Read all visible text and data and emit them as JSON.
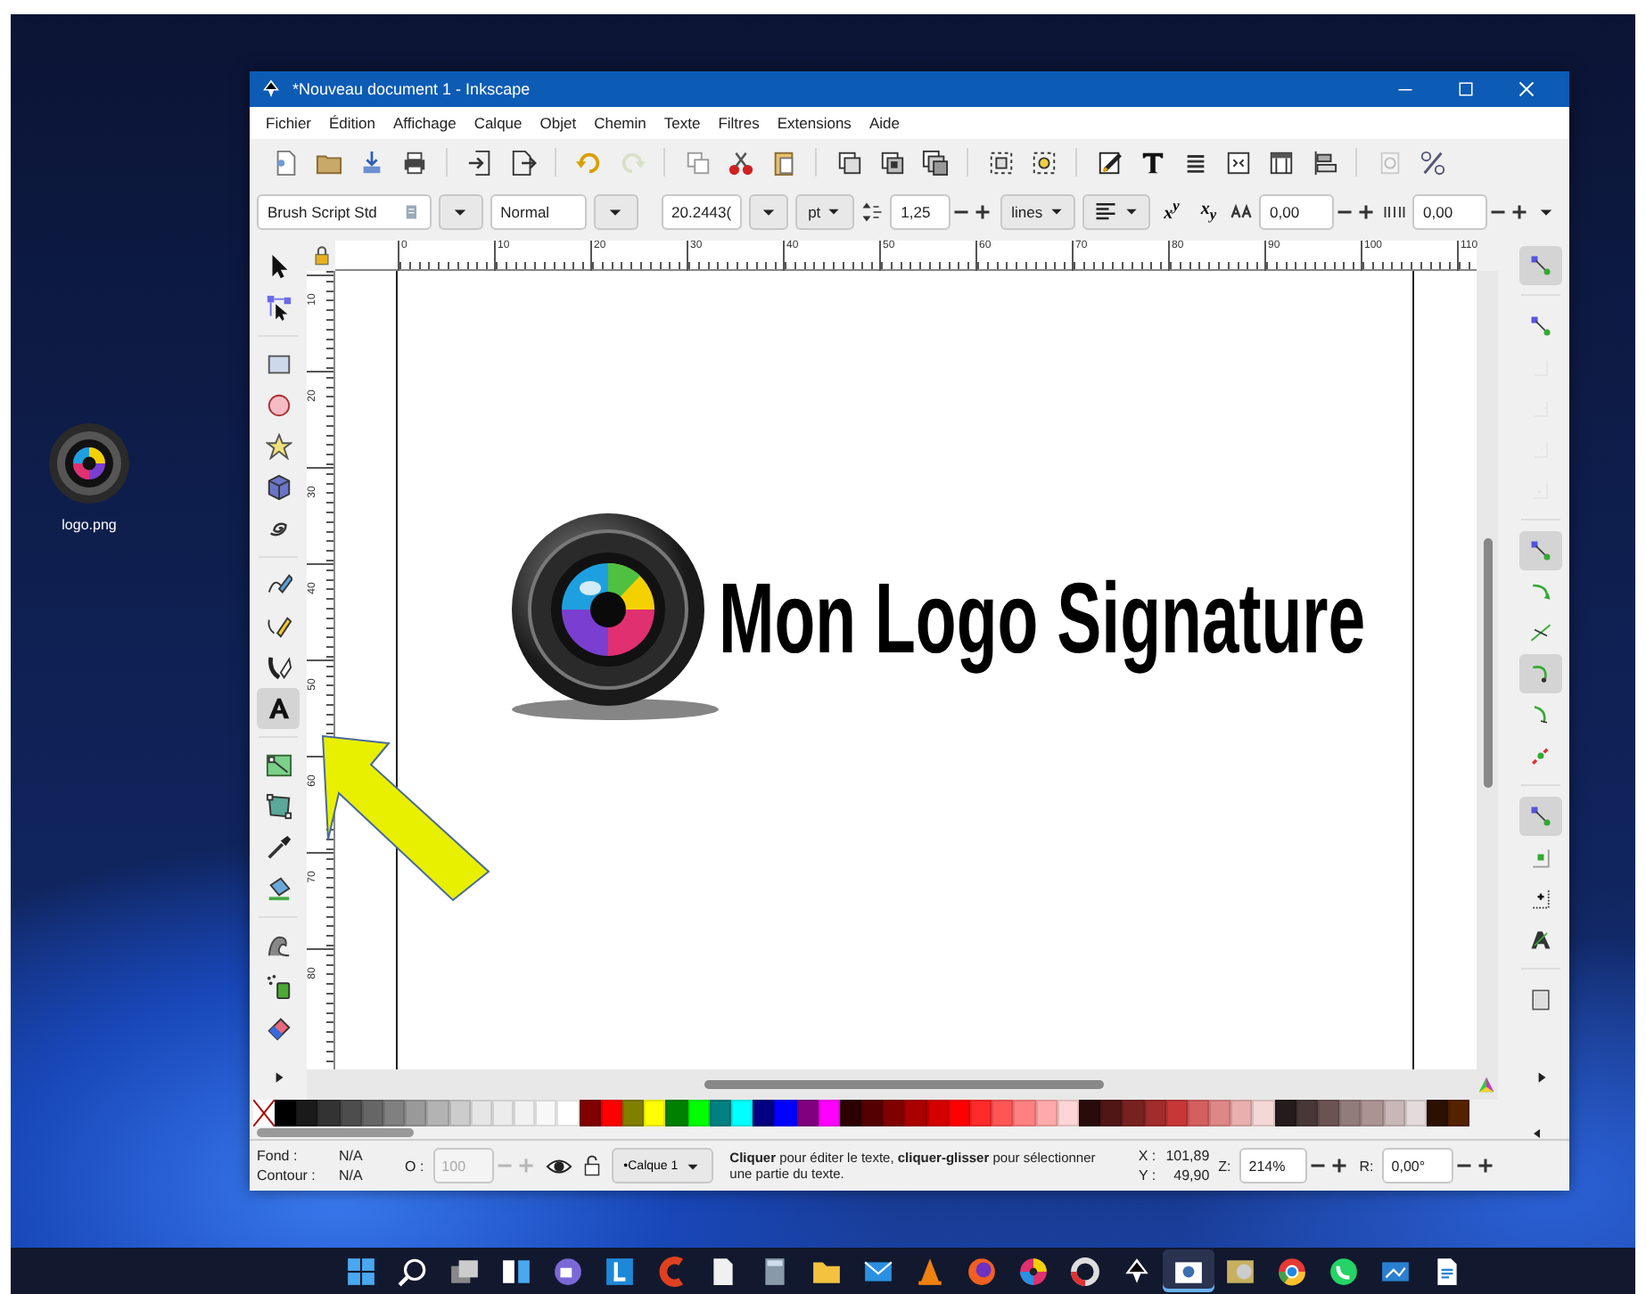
{
  "desktop_icons": [
    {
      "label": "logo.png"
    }
  ],
  "window": {
    "title": "*Nouveau document 1 - Inkscape"
  },
  "menu": [
    "Fichier",
    "Édition",
    "Affichage",
    "Calque",
    "Objet",
    "Chemin",
    "Texte",
    "Filtres",
    "Extensions",
    "Aide"
  ],
  "text_toolbar": {
    "font_family": "Brush Script Std",
    "font_style": "Normal",
    "font_size": "20.2443(",
    "unit": "pt",
    "line_spacing": "1,25",
    "line_spacing_mode": "lines",
    "superscript": "x$^{y}$",
    "subscript": "x$_{y}$",
    "word_spacing": "0,00",
    "letter_spacing": "0,00"
  },
  "tools": [
    {
      "selected": false
    },
    {
      "selected": false
    },
    {
      "selected": false
    },
    {
      "selected": false
    },
    {
      "selected": false
    },
    {
      "selected": false
    },
    {
      "selected": false
    },
    {
      "selected": false
    },
    {
      "selected": false
    },
    {
      "selected": false
    },
    {
      "selected": true
    },
    {
      "selected": false
    },
    {
      "selected": false
    },
    {
      "selected": false
    },
    {
      "selected": false
    },
    {
      "selected": false
    },
    {
      "selected": false
    },
    {
      "selected": false
    }
  ],
  "rulers": {
    "horizontal": [
      "0",
      "10",
      "20",
      "30",
      "40",
      "50",
      "60",
      "70",
      "80",
      "90",
      "100",
      "110"
    ],
    "vertical": [
      "10",
      "20",
      "30",
      "40",
      "50",
      "60",
      "70",
      "80"
    ]
  },
  "canvas": {
    "logo_text": "Mon Logo Signature"
  },
  "snap_toggles": [
    {
      "on": true,
      "disabled": false
    },
    {
      "on": false,
      "disabled": false
    },
    {
      "on": false,
      "disabled": true
    },
    {
      "on": false,
      "disabled": true
    },
    {
      "on": false,
      "disabled": true
    },
    {
      "on": false,
      "disabled": true
    },
    {
      "on": true,
      "disabled": false
    },
    {
      "on": false,
      "disabled": false
    },
    {
      "on": false,
      "disabled": false
    },
    {
      "on": true,
      "disabled": false
    },
    {
      "on": false,
      "disabled": false
    },
    {
      "on": false,
      "disabled": false
    },
    {
      "on": true,
      "disabled": false
    },
    {
      "on": false,
      "disabled": false
    },
    {
      "on": false,
      "disabled": false
    },
    {
      "on": false,
      "disabled": false
    },
    {
      "on": false,
      "disabled": false
    }
  ],
  "palette": [
    {
      "color": "#000000"
    },
    {
      "color": "#1a1a1a"
    },
    {
      "color": "#333333"
    },
    {
      "color": "#4d4d4d"
    },
    {
      "color": "#666666"
    },
    {
      "color": "#808080"
    },
    {
      "color": "#999999"
    },
    {
      "color": "#b3b3b3"
    },
    {
      "color": "#cccccc"
    },
    {
      "color": "#e6e6e6"
    },
    {
      "color": "#ececec"
    },
    {
      "color": "#f2f2f2"
    },
    {
      "color": "#f8f8f8"
    },
    {
      "color": "#ffffff"
    },
    {
      "color": "#800000"
    },
    {
      "color": "#ff0000"
    },
    {
      "color": "#808000"
    },
    {
      "color": "#ffff00"
    },
    {
      "color": "#008000"
    },
    {
      "color": "#00ff00"
    },
    {
      "color": "#008080"
    },
    {
      "color": "#00ffff"
    },
    {
      "color": "#000080"
    },
    {
      "color": "#0000ff"
    },
    {
      "color": "#800080"
    },
    {
      "color": "#ff00ff"
    },
    {
      "color": "#2b0000"
    },
    {
      "color": "#550000"
    },
    {
      "color": "#800000"
    },
    {
      "color": "#aa0000"
    },
    {
      "color": "#d40000"
    },
    {
      "color": "#ff0000"
    },
    {
      "color": "#ff2a2a"
    },
    {
      "color": "#ff5555"
    },
    {
      "color": "#ff8080"
    },
    {
      "color": "#ffaaaa"
    },
    {
      "color": "#ffd5d5"
    },
    {
      "color": "#280b0b"
    },
    {
      "color": "#501616"
    },
    {
      "color": "#782121"
    },
    {
      "color": "#a02c2c"
    },
    {
      "color": "#c83737"
    },
    {
      "color": "#d35f5f"
    },
    {
      "color": "#de8787"
    },
    {
      "color": "#e9afaf"
    },
    {
      "color": "#f4d7d7"
    },
    {
      "color": "#241c1c"
    },
    {
      "color": "#483737"
    },
    {
      "color": "#6c5353"
    },
    {
      "color": "#917c7c"
    },
    {
      "color": "#ac9393"
    },
    {
      "color": "#c8b7b7"
    },
    {
      "color": "#e3dbdb"
    },
    {
      "color": "#2b1100"
    },
    {
      "color": "#552200"
    }
  ],
  "status_bar": {
    "fill_label": "Fond :",
    "fill_value": "N/A",
    "stroke_label": "Contour :",
    "stroke_value": "N/A",
    "opacity_label": "O :",
    "opacity_value": "100",
    "opacity_disabled": true,
    "layer": "•Calque 1",
    "message": "**Cliquer** pour éditer le texte, **cliquer-glisser** pour sélectionner une partie du texte.",
    "x_label": "X :",
    "x_value": "101,89",
    "y_label": "Y :",
    "y_value": "49,90",
    "zoom_label": "Z:",
    "zoom_value": "214%",
    "rotation_label": "R:",
    "rotation_value": "0,00°"
  },
  "taskbar": [
    {
      "active": false
    },
    {
      "active": false
    },
    {
      "active": false
    },
    {
      "active": false
    },
    {
      "active": false
    },
    {
      "active": false
    },
    {
      "active": false
    },
    {
      "active": false
    },
    {
      "active": false
    },
    {
      "active": false
    },
    {
      "active": false
    },
    {
      "active": false
    },
    {
      "active": false
    },
    {
      "active": false
    },
    {
      "active": false
    },
    {
      "active": false
    },
    {
      "active": true
    },
    {
      "active": false
    },
    {
      "active": false
    },
    {
      "active": false
    },
    {
      "active": false
    },
    {
      "active": false
    }
  ]
}
